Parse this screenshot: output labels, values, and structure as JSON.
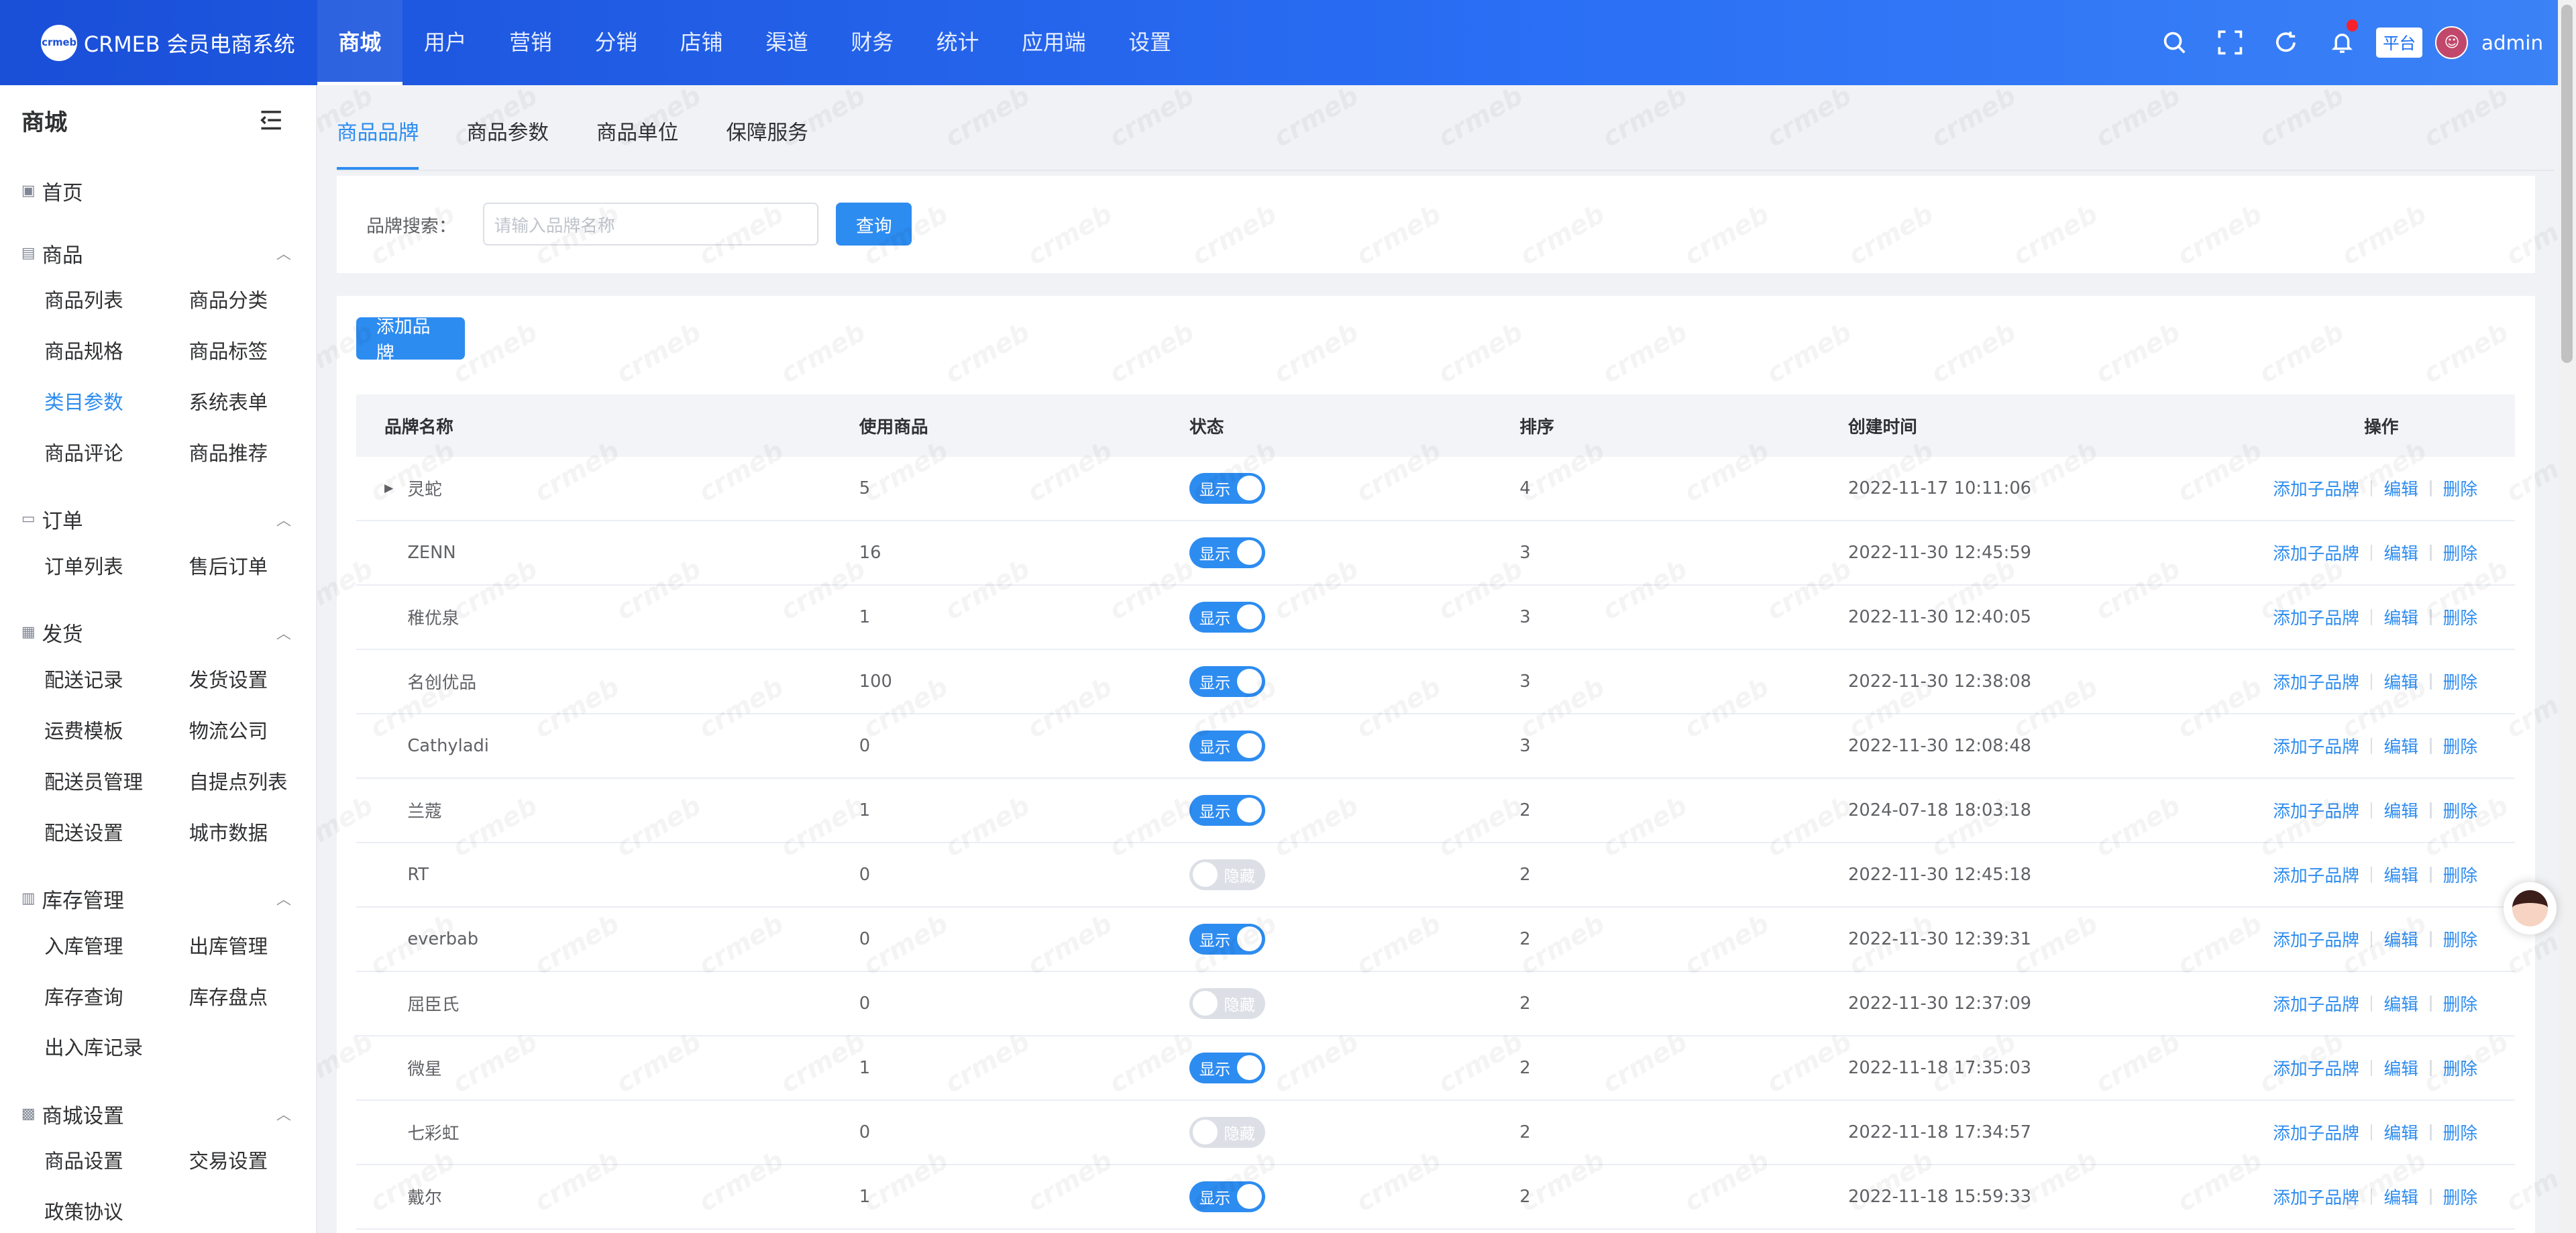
{
  "header": {
    "logo_mark": "crmeb",
    "logo_text": "CRMEB 会员电商系统",
    "nav": [
      "商城",
      "用户",
      "营销",
      "分销",
      "店铺",
      "渠道",
      "财务",
      "统计",
      "应用端",
      "设置"
    ],
    "nav_active": 0,
    "platform_badge": "平台",
    "username": "admin"
  },
  "sidebar": {
    "title": "商城",
    "home": "首页",
    "groups": [
      {
        "label": "商品",
        "items": [
          "商品列表",
          "商品分类",
          "商品规格",
          "商品标签",
          "类目参数",
          "系统表单",
          "商品评论",
          "商品推荐"
        ],
        "active": "类目参数"
      },
      {
        "label": "订单",
        "items": [
          "订单列表",
          "售后订单"
        ]
      },
      {
        "label": "发货",
        "items": [
          "配送记录",
          "发货设置",
          "运费模板",
          "物流公司",
          "配送员管理",
          "自提点列表",
          "配送设置",
          "城市数据"
        ]
      },
      {
        "label": "库存管理",
        "items": [
          "入库管理",
          "出库管理",
          "库存查询",
          "库存盘点",
          "出入库记录"
        ]
      },
      {
        "label": "商城设置",
        "items": [
          "商品设置",
          "交易设置",
          "政策协议"
        ]
      }
    ]
  },
  "tabs": [
    "商品品牌",
    "商品参数",
    "商品单位",
    "保障服务"
  ],
  "filter": {
    "label": "品牌搜索：",
    "placeholder": "请输入品牌名称",
    "button": "查询"
  },
  "add_button": "添加品牌",
  "table": {
    "headers": [
      "品牌名称",
      "使用商品",
      "状态",
      "排序",
      "创建时间",
      "操作"
    ],
    "actions": [
      "添加子品牌",
      "编辑",
      "删除"
    ],
    "rows": [
      {
        "name": "灵蛇",
        "count": "5",
        "status": "显示",
        "on": true,
        "sort": "4",
        "time": "2022-11-17 10:11:06",
        "expand": true
      },
      {
        "name": "ZENN",
        "count": "16",
        "status": "显示",
        "on": true,
        "sort": "3",
        "time": "2022-11-30 12:45:59"
      },
      {
        "name": "稚优泉",
        "count": "1",
        "status": "显示",
        "on": true,
        "sort": "3",
        "time": "2022-11-30 12:40:05"
      },
      {
        "name": "名创优品",
        "count": "100",
        "status": "显示",
        "on": true,
        "sort": "3",
        "time": "2022-11-30 12:38:08"
      },
      {
        "name": "Cathyladi",
        "count": "0",
        "status": "显示",
        "on": true,
        "sort": "3",
        "time": "2022-11-30 12:08:48"
      },
      {
        "name": "兰蔻",
        "count": "1",
        "status": "显示",
        "on": true,
        "sort": "2",
        "time": "2024-07-18 18:03:18"
      },
      {
        "name": "RT",
        "count": "0",
        "status": "隐藏",
        "on": false,
        "sort": "2",
        "time": "2022-11-30 12:45:18"
      },
      {
        "name": "everbab",
        "count": "0",
        "status": "显示",
        "on": true,
        "sort": "2",
        "time": "2022-11-30 12:39:31"
      },
      {
        "name": "屈臣氏",
        "count": "0",
        "status": "隐藏",
        "on": false,
        "sort": "2",
        "time": "2022-11-30 12:37:09"
      },
      {
        "name": "微星",
        "count": "1",
        "status": "显示",
        "on": true,
        "sort": "2",
        "time": "2022-11-18 17:35:03"
      },
      {
        "name": "七彩虹",
        "count": "0",
        "status": "隐藏",
        "on": false,
        "sort": "2",
        "time": "2022-11-18 17:34:57"
      },
      {
        "name": "戴尔",
        "count": "1",
        "status": "显示",
        "on": true,
        "sort": "2",
        "time": "2022-11-18 15:59:33"
      }
    ]
  },
  "watermark_text": "crmeb"
}
